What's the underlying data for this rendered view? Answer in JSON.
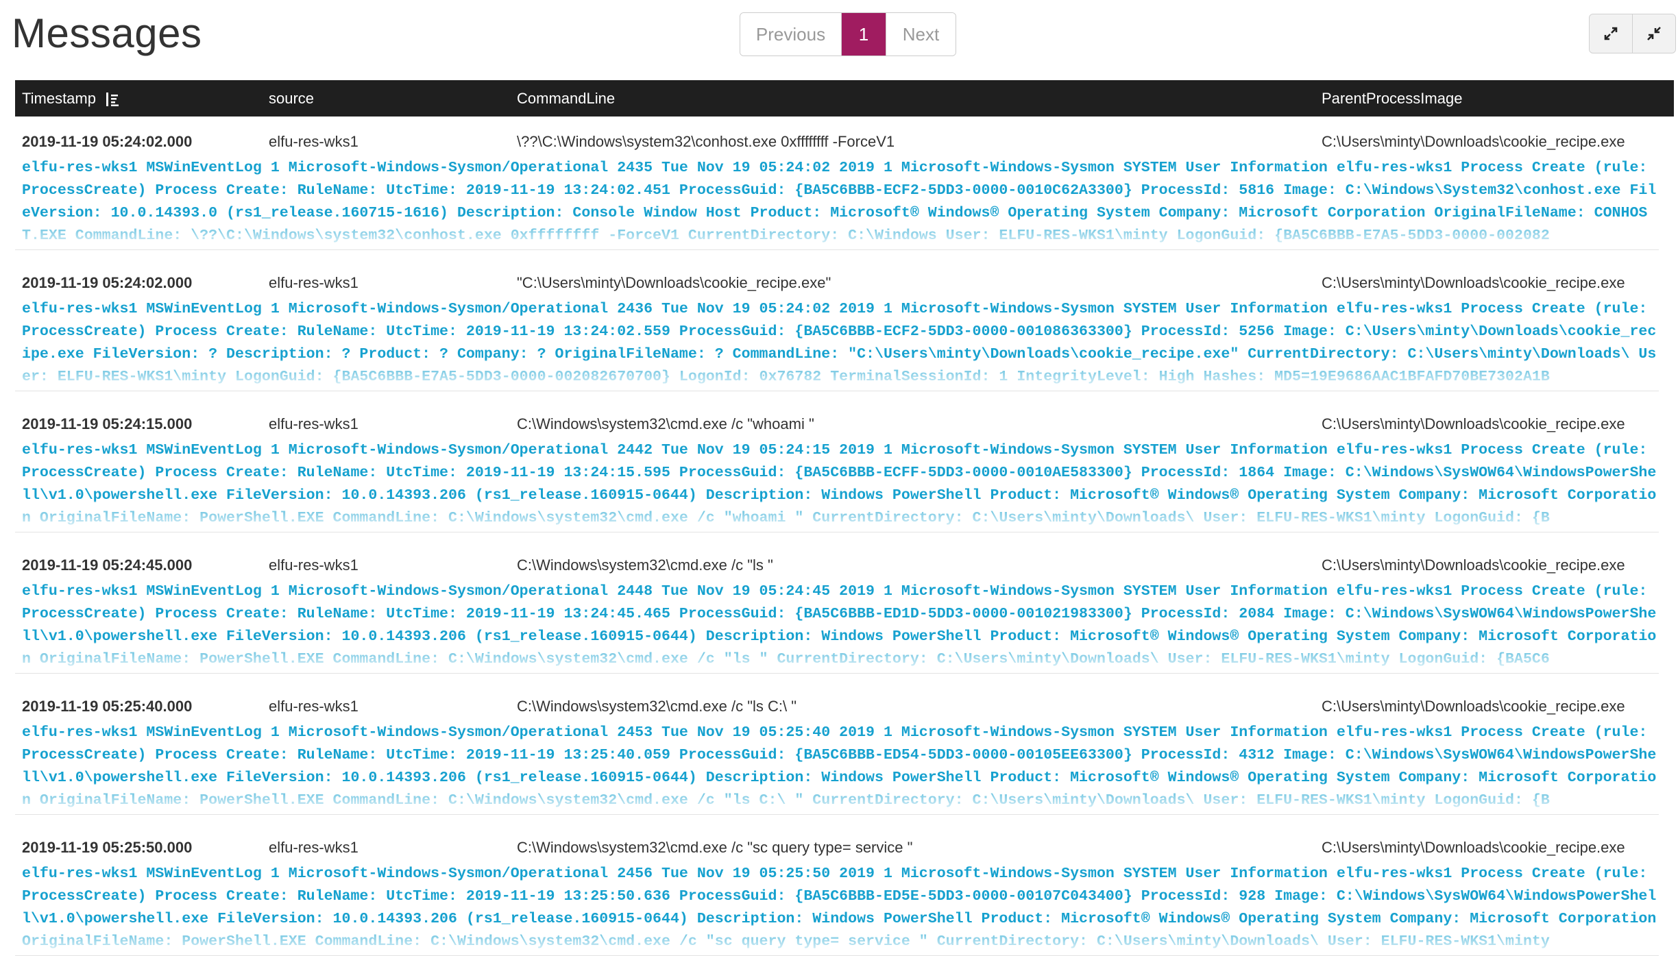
{
  "title": "Messages",
  "pagination": {
    "previous": "Previous",
    "current": "1",
    "next": "Next"
  },
  "toolbar": {
    "expand_icon": "expand-icon",
    "collapse_icon": "collapse-icon"
  },
  "columns": {
    "timestamp": "Timestamp",
    "source": "source",
    "commandline": "CommandLine",
    "parent": "ParentProcessImage"
  },
  "rows": [
    {
      "timestamp": "2019-11-19 05:24:02.000",
      "source": "elfu-res-wks1",
      "commandline": "\\??\\C:\\Windows\\system32\\conhost.exe 0xffffffff -ForceV1",
      "parent": "C:\\Users\\minty\\Downloads\\cookie_recipe.exe",
      "message": "elfu-res-wks1 MSWinEventLog 1 Microsoft-Windows-Sysmon/Operational 2435 Tue Nov 19 05:24:02 2019 1 Microsoft-Windows-Sysmon SYSTEM User Information elfu-res-wks1 Process Create (rule: ProcessCreate) Process Create: RuleName: UtcTime: 2019-11-19 13:24:02.451 ProcessGuid: {BA5C6BBB-ECF2-5DD3-0000-0010C62A3300} ProcessId: 5816 Image: C:\\Windows\\System32\\conhost.exe FileVersion: 10.0.14393.0 (rs1_release.160715-1616) Description: Console Window Host Product: Microsoft® Windows® Operating System Company: Microsoft Corporation OriginalFileName: CONHOST.EXE CommandLine: \\??\\C:\\Windows\\system32\\conhost.exe 0xffffffff -ForceV1 CurrentDirectory: C:\\Windows User: ELFU-RES-WKS1\\minty LogonGuid: {BA5C6BBB-E7A5-5DD3-0000-002082"
    },
    {
      "timestamp": "2019-11-19 05:24:02.000",
      "source": "elfu-res-wks1",
      "commandline": "\"C:\\Users\\minty\\Downloads\\cookie_recipe.exe\"",
      "parent": "C:\\Users\\minty\\Downloads\\cookie_recipe.exe",
      "message": "elfu-res-wks1 MSWinEventLog 1 Microsoft-Windows-Sysmon/Operational 2436 Tue Nov 19 05:24:02 2019 1 Microsoft-Windows-Sysmon SYSTEM User Information elfu-res-wks1 Process Create (rule: ProcessCreate) Process Create: RuleName: UtcTime: 2019-11-19 13:24:02.559 ProcessGuid: {BA5C6BBB-ECF2-5DD3-0000-001086363300} ProcessId: 5256 Image: C:\\Users\\minty\\Downloads\\cookie_recipe.exe FileVersion: ? Description: ? Product: ? Company: ? OriginalFileName: ? CommandLine: \"C:\\Users\\minty\\Downloads\\cookie_recipe.exe\" CurrentDirectory: C:\\Users\\minty\\Downloads\\ User: ELFU-RES-WKS1\\minty LogonGuid: {BA5C6BBB-E7A5-5DD3-0000-002082670700} LogonId: 0x76782 TerminalSessionId: 1 IntegrityLevel: High Hashes: MD5=19E9686AAC1BFAFD70BE7302A1B"
    },
    {
      "timestamp": "2019-11-19 05:24:15.000",
      "source": "elfu-res-wks1",
      "commandline": "C:\\Windows\\system32\\cmd.exe /c \"whoami \"",
      "parent": "C:\\Users\\minty\\Downloads\\cookie_recipe.exe",
      "message": "elfu-res-wks1 MSWinEventLog 1 Microsoft-Windows-Sysmon/Operational 2442 Tue Nov 19 05:24:15 2019 1 Microsoft-Windows-Sysmon SYSTEM User Information elfu-res-wks1 Process Create (rule: ProcessCreate) Process Create: RuleName: UtcTime: 2019-11-19 13:24:15.595 ProcessGuid: {BA5C6BBB-ECFF-5DD3-0000-0010AE583300} ProcessId: 1864 Image: C:\\Windows\\SysWOW64\\WindowsPowerShell\\v1.0\\powershell.exe FileVersion: 10.0.14393.206 (rs1_release.160915-0644) Description: Windows PowerShell Product: Microsoft® Windows® Operating System Company: Microsoft Corporation OriginalFileName: PowerShell.EXE CommandLine: C:\\Windows\\system32\\cmd.exe /c \"whoami \" CurrentDirectory: C:\\Users\\minty\\Downloads\\ User: ELFU-RES-WKS1\\minty LogonGuid: {B"
    },
    {
      "timestamp": "2019-11-19 05:24:45.000",
      "source": "elfu-res-wks1",
      "commandline": "C:\\Windows\\system32\\cmd.exe /c \"ls \"",
      "parent": "C:\\Users\\minty\\Downloads\\cookie_recipe.exe",
      "message": "elfu-res-wks1 MSWinEventLog 1 Microsoft-Windows-Sysmon/Operational 2448 Tue Nov 19 05:24:45 2019 1 Microsoft-Windows-Sysmon SYSTEM User Information elfu-res-wks1 Process Create (rule: ProcessCreate) Process Create: RuleName: UtcTime: 2019-11-19 13:24:45.465 ProcessGuid: {BA5C6BBB-ED1D-5DD3-0000-001021983300} ProcessId: 2084 Image: C:\\Windows\\SysWOW64\\WindowsPowerShell\\v1.0\\powershell.exe FileVersion: 10.0.14393.206 (rs1_release.160915-0644) Description: Windows PowerShell Product: Microsoft® Windows® Operating System Company: Microsoft Corporation OriginalFileName: PowerShell.EXE CommandLine: C:\\Windows\\system32\\cmd.exe /c \"ls \" CurrentDirectory: C:\\Users\\minty\\Downloads\\ User: ELFU-RES-WKS1\\minty LogonGuid: {BA5C6"
    },
    {
      "timestamp": "2019-11-19 05:25:40.000",
      "source": "elfu-res-wks1",
      "commandline": "C:\\Windows\\system32\\cmd.exe /c \"ls C:\\ \"",
      "parent": "C:\\Users\\minty\\Downloads\\cookie_recipe.exe",
      "message": "elfu-res-wks1 MSWinEventLog 1 Microsoft-Windows-Sysmon/Operational 2453 Tue Nov 19 05:25:40 2019 1 Microsoft-Windows-Sysmon SYSTEM User Information elfu-res-wks1 Process Create (rule: ProcessCreate) Process Create: RuleName: UtcTime: 2019-11-19 13:25:40.059 ProcessGuid: {BA5C6BBB-ED54-5DD3-0000-00105EE63300} ProcessId: 4312 Image: C:\\Windows\\SysWOW64\\WindowsPowerShell\\v1.0\\powershell.exe FileVersion: 10.0.14393.206 (rs1_release.160915-0644) Description: Windows PowerShell Product: Microsoft® Windows® Operating System Company: Microsoft Corporation OriginalFileName: PowerShell.EXE CommandLine: C:\\Windows\\system32\\cmd.exe /c \"ls C:\\ \" CurrentDirectory: C:\\Users\\minty\\Downloads\\ User: ELFU-RES-WKS1\\minty LogonGuid: {B"
    },
    {
      "timestamp": "2019-11-19 05:25:50.000",
      "source": "elfu-res-wks1",
      "commandline": "C:\\Windows\\system32\\cmd.exe /c \"sc query type= service \"",
      "parent": "C:\\Users\\minty\\Downloads\\cookie_recipe.exe",
      "message": "elfu-res-wks1 MSWinEventLog 1 Microsoft-Windows-Sysmon/Operational 2456 Tue Nov 19 05:25:50 2019 1 Microsoft-Windows-Sysmon SYSTEM User Information elfu-res-wks1 Process Create (rule: ProcessCreate) Process Create: RuleName: UtcTime: 2019-11-19 13:25:50.636 ProcessGuid: {BA5C6BBB-ED5E-5DD3-0000-00107C043400} ProcessId: 928 Image: C:\\Windows\\SysWOW64\\WindowsPowerShell\\v1.0\\powershell.exe FileVersion: 10.0.14393.206 (rs1_release.160915-0644) Description: Windows PowerShell Product: Microsoft® Windows® Operating System Company: Microsoft Corporation OriginalFileName: PowerShell.EXE CommandLine: C:\\Windows\\system32\\cmd.exe /c \"sc query type= service \" CurrentDirectory: C:\\Users\\minty\\Downloads\\ User: ELFU-RES-WKS1\\minty"
    }
  ]
}
